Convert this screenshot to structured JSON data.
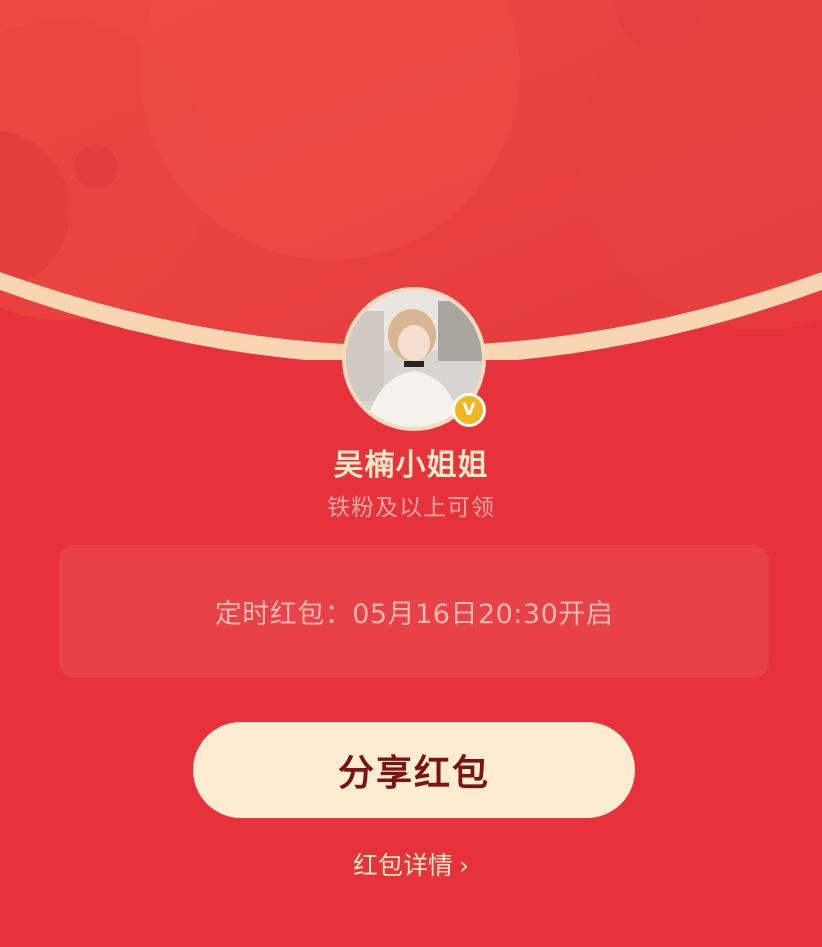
{
  "colors": {
    "background": "#e8323b",
    "flap": "#e94a42",
    "flap_edge": "#f8d6b4",
    "name_text": "#fde8c8",
    "muted_text": "#f4a7a0",
    "button_bg": "#fdebd2",
    "button_text": "#7a1414",
    "badge": "#f2b71e"
  },
  "sender": {
    "name": "吴楠小姐姐",
    "eligibility": "铁粉及以上可领",
    "badge_glyph": "V"
  },
  "timer": {
    "text": "定时红包：05月16日20:30开启"
  },
  "actions": {
    "share_label": "分享红包",
    "details_label": "红包详情",
    "details_chevron": "›"
  }
}
